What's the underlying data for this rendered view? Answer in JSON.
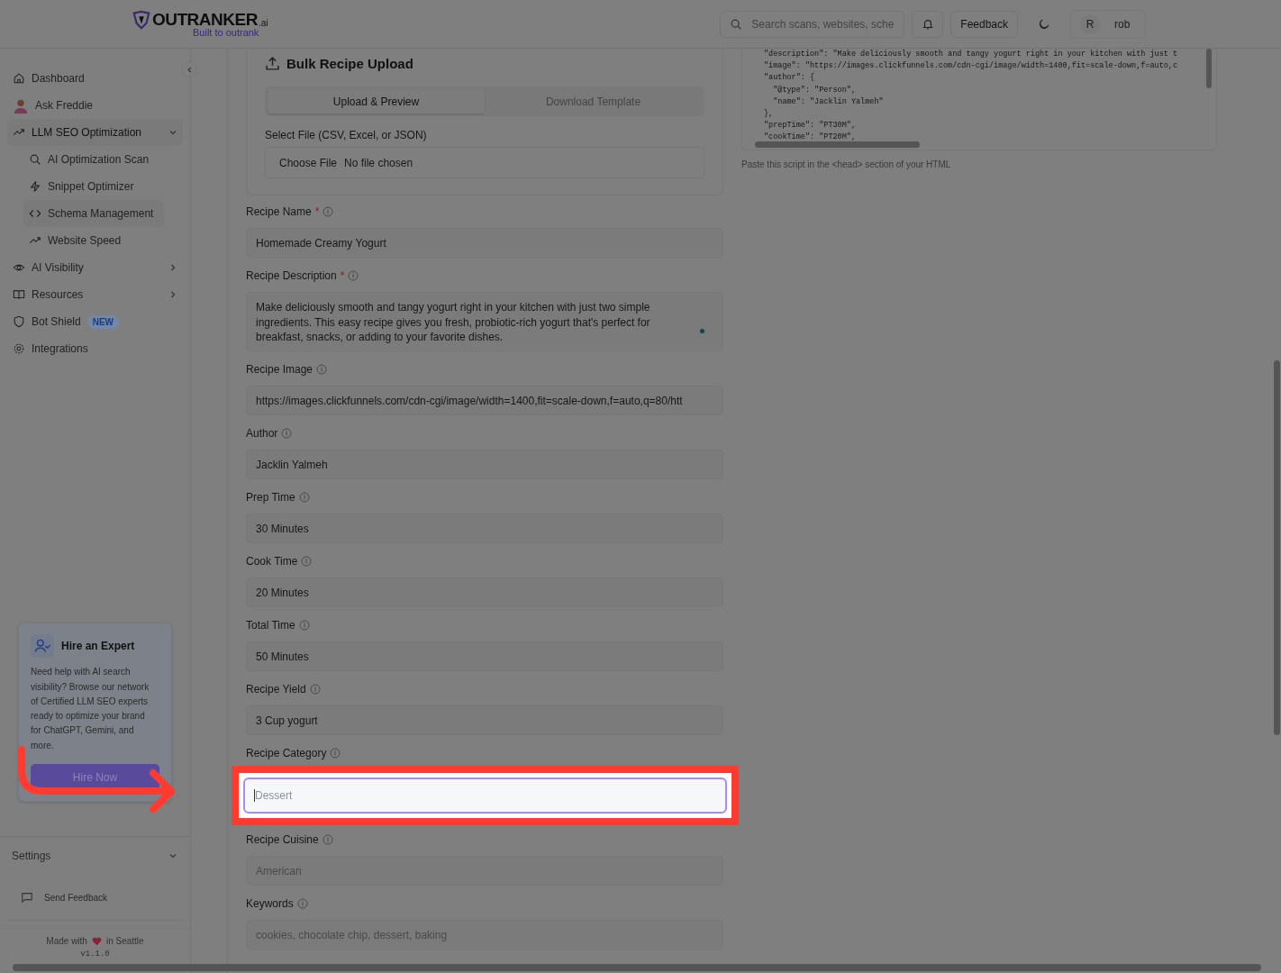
{
  "header": {
    "logo": {
      "name": "OUTRANKER",
      "suffix": ".ai",
      "tagline": "Built to outrank"
    },
    "search": {
      "placeholder": "Search scans, websites, sche"
    },
    "feedback_button": "Feedback",
    "user": {
      "initial": "R",
      "name": "rob"
    }
  },
  "sidebar": {
    "items": [
      {
        "label": "Dashboard",
        "kind": "link",
        "selected": false
      },
      {
        "label": "Ask Freddie",
        "kind": "avatar",
        "selected": false
      },
      {
        "label": "LLM SEO Optimization",
        "kind": "group",
        "selected": false,
        "expanded": true,
        "children": [
          {
            "label": "AI Optimization Scan",
            "selected": false
          },
          {
            "label": "Snippet Optimizer",
            "selected": false
          },
          {
            "label": "Schema Management",
            "selected": true
          },
          {
            "label": "Website Speed",
            "selected": false
          }
        ]
      },
      {
        "label": "AI Visibility",
        "kind": "group",
        "selected": false,
        "expanded": false
      },
      {
        "label": "Resources",
        "kind": "group",
        "selected": false,
        "expanded": false
      },
      {
        "label": "Bot Shield",
        "kind": "link",
        "selected": false,
        "badge": "NEW"
      },
      {
        "label": "Integrations",
        "kind": "link",
        "selected": false
      }
    ],
    "hire_card": {
      "title": "Hire an Expert",
      "text": "Need help with AI search visibility? Browse our network of Certified LLM SEO experts ready to optimize your brand for ChatGPT, Gemini, and more.",
      "button": "Hire Now"
    },
    "settings": "Settings",
    "send_feedback": "Send Feedback",
    "footer": {
      "made_with": "Made with",
      "place": "in Seattle",
      "version": "v1.1.0"
    }
  },
  "bulk_upload": {
    "title": "Bulk Recipe Upload",
    "tabs": [
      {
        "label": "Upload & Preview",
        "selected": true
      },
      {
        "label": "Download Template",
        "selected": false
      }
    ],
    "file_label": "Select File (CSV, Excel, or JSON)",
    "file_button": "Choose File",
    "file_status": "No file chosen"
  },
  "fields": [
    {
      "label": "Recipe Name",
      "required_mark": "*",
      "kind": "input",
      "value": "Homemade Creamy Yogurt",
      "highlighted": false
    },
    {
      "label": "Recipe Description",
      "required_mark": "*",
      "kind": "textarea",
      "value": "Make deliciously smooth and tangy yogurt right in your kitchen with just two simple ingredients. This easy recipe gives you fresh, probiotic-rich yogurt that's perfect for breakfast, snacks, or adding to your favorite dishes.",
      "highlighted": false
    },
    {
      "label": "Recipe Image",
      "kind": "input",
      "value": "https://images.clickfunnels.com/cdn-cgi/image/width=1400,fit=scale-down,f=auto,q=80/htt",
      "highlighted": false
    },
    {
      "label": "Author",
      "kind": "input",
      "value": "Jacklin Yalmeh",
      "highlighted": false
    },
    {
      "label": "Prep Time",
      "kind": "input",
      "value": "30 Minutes",
      "highlighted": false
    },
    {
      "label": "Cook Time",
      "kind": "input",
      "value": "20 Minutes",
      "highlighted": false
    },
    {
      "label": "Total Time",
      "kind": "input",
      "value": "50 Minutes",
      "highlighted": false
    },
    {
      "label": "Recipe Yield",
      "kind": "input",
      "value": "3 Cup yogurt",
      "highlighted": false
    },
    {
      "label": "Recipe Category",
      "kind": "input",
      "placeholder": "Dessert",
      "highlighted": true
    },
    {
      "label": "Recipe Cuisine",
      "kind": "input",
      "placeholder": "American",
      "highlighted": false
    },
    {
      "label": "Keywords",
      "kind": "input",
      "placeholder": "cookies, chocolate chip, dessert, baking",
      "highlighted": false
    }
  ],
  "code_panel": {
    "lines": [
      "\"description\": \"Make deliciously smooth and tangy yogurt right in your kitchen with just t",
      "\"image\": \"https://images.clickfunnels.com/cdn-cgi/image/width=1400,fit=scale-down,f=auto,c",
      "\"author\": {",
      "  \"@type\": \"Person\",",
      "  \"name\": \"Jacklin Yalmeh\"",
      "},",
      "\"prepTime\": \"PT30M\",",
      "\"cookTime\": \"PT20M\","
    ],
    "hint": "Paste this script in the <head> section of your HTML"
  }
}
